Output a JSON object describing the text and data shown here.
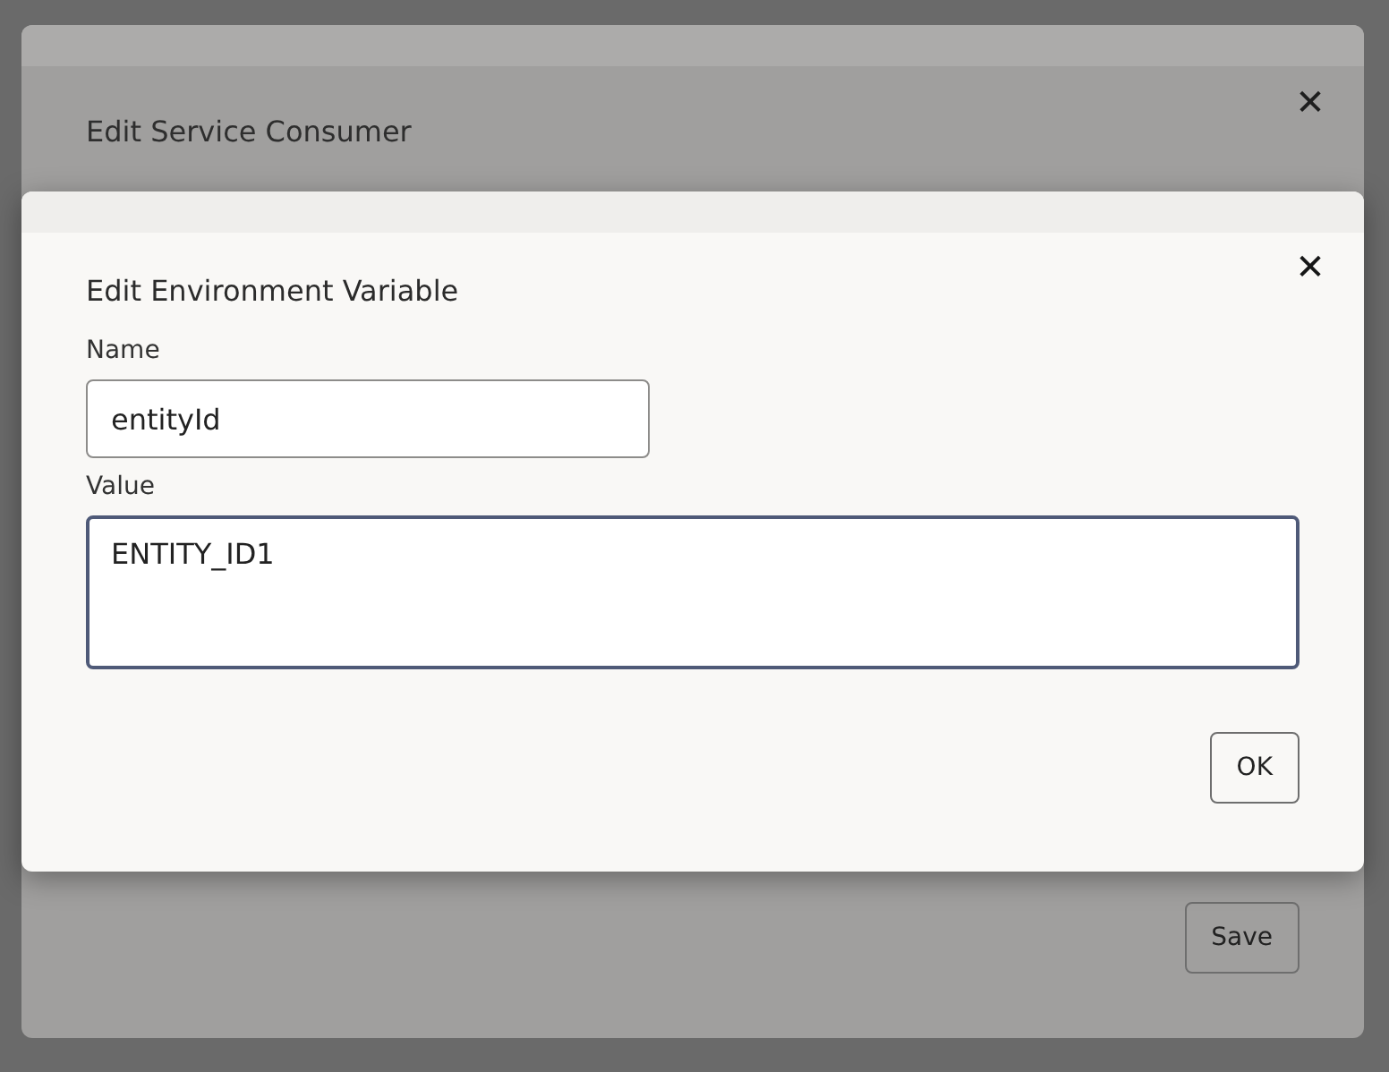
{
  "back_dialog": {
    "title": "Edit Service Consumer",
    "close": "✕",
    "buttons": [
      "Save"
    ]
  },
  "dialog": {
    "title": "Edit Environment Variable",
    "close": "✕",
    "fields": [
      {
        "label": "Name",
        "value": "entityId",
        "kind": "input",
        "focused": false
      },
      {
        "label": "Value",
        "value": "ENTITY_ID1",
        "kind": "textarea",
        "focused": true
      }
    ],
    "buttons": [
      "OK"
    ]
  }
}
